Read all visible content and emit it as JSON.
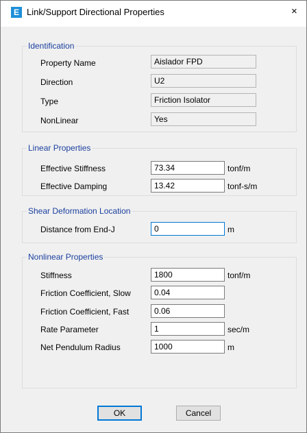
{
  "window": {
    "title": "Link/Support Directional Properties",
    "icon_letter": "E",
    "close_glyph": "×",
    "accent": "#1e8fd9"
  },
  "identification": {
    "heading": "Identification",
    "property_name_label": "Property Name",
    "property_name_value": "Aislador FPD",
    "direction_label": "Direction",
    "direction_value": "U2",
    "type_label": "Type",
    "type_value": "Friction Isolator",
    "nonlinear_label": "NonLinear",
    "nonlinear_value": "Yes"
  },
  "linear": {
    "heading": "Linear Properties",
    "stiffness_label": "Effective Stiffness",
    "stiffness_value": "73.34",
    "stiffness_unit": "tonf/m",
    "damping_label": "Effective Damping",
    "damping_value": "13.42",
    "damping_unit": "tonf-s/m"
  },
  "shear": {
    "heading": "Shear Deformation Location",
    "distance_label": "Distance from End-J",
    "distance_value": "0",
    "distance_unit": "m"
  },
  "nonlinear": {
    "heading": "Nonlinear Properties",
    "stiffness_label": "Stiffness",
    "stiffness_value": "1800",
    "stiffness_unit": "tonf/m",
    "fric_slow_label": "Friction Coefficient, Slow",
    "fric_slow_value": "0.04",
    "fric_fast_label": "Friction Coefficient, Fast",
    "fric_fast_value": "0.06",
    "rate_label": "Rate Parameter",
    "rate_value": "1",
    "rate_unit": "sec/m",
    "radius_label": "Net Pendulum Radius",
    "radius_value": "1000",
    "radius_unit": "m"
  },
  "buttons": {
    "ok": "OK",
    "cancel": "Cancel"
  }
}
